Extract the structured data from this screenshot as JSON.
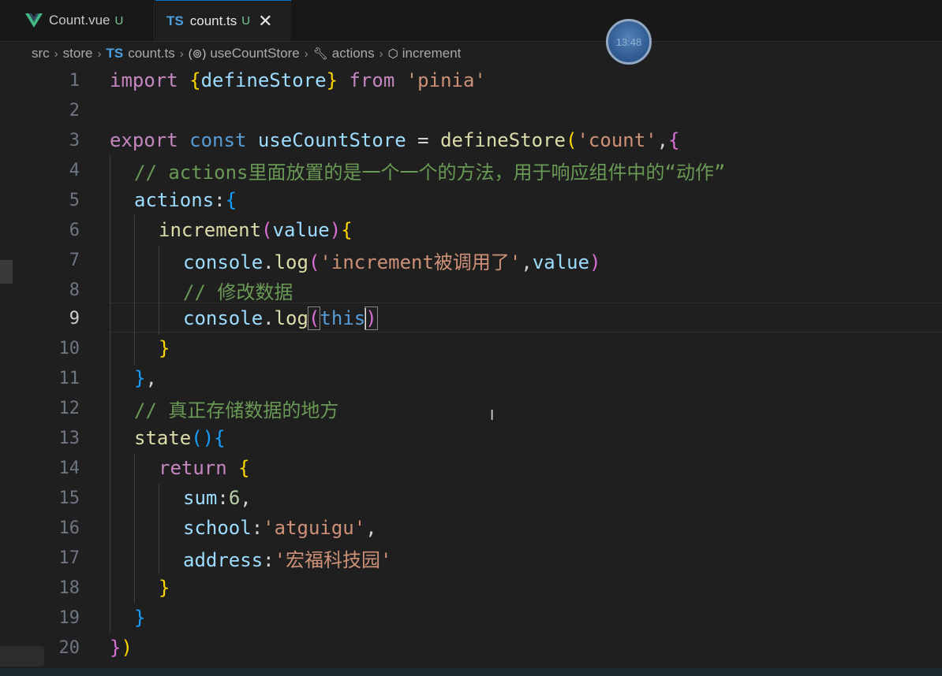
{
  "tabs": [
    {
      "label": "Count.vue",
      "status": "U",
      "icon": "vue-icon",
      "active": false
    },
    {
      "label": "count.ts",
      "status": "U",
      "icon": "typescript-icon",
      "active": true,
      "close": "✕"
    }
  ],
  "clock": {
    "time": "13:48"
  },
  "breadcrumb": {
    "src": "src",
    "store": "store",
    "ts_badge": "TS",
    "file": "count.ts",
    "symbol1": "useCountStore",
    "symbol2": "actions",
    "symbol3": "increment"
  },
  "editor": {
    "active_line": 9,
    "line_numbers": [
      "1",
      "2",
      "3",
      "4",
      "5",
      "6",
      "7",
      "8",
      "9",
      "10",
      "11",
      "12",
      "13",
      "14",
      "15",
      "16",
      "17",
      "18",
      "19",
      "20"
    ],
    "tokens": {
      "l1": [
        "import ",
        "{",
        "defineStore",
        "}",
        " from ",
        "'pinia'"
      ],
      "l3": [
        "export ",
        "const ",
        "useCountStore",
        " = ",
        "defineStore",
        "(",
        "'count'",
        ",",
        "{"
      ],
      "l4": "// actions里面放置的是一个一个的方法，用于响应组件中的“动作”",
      "l5": [
        "actions",
        ":",
        "{"
      ],
      "l6": [
        "increment",
        "(",
        "value",
        ")",
        "{"
      ],
      "l7": [
        "console",
        ".",
        "log",
        "(",
        "'increment被调用了'",
        ",",
        "value",
        ")"
      ],
      "l8": "// 修改数据",
      "l9": [
        "console",
        ".",
        "log",
        "(",
        "this",
        ")"
      ],
      "l10": "}",
      "l11": [
        "}",
        ","
      ],
      "l12": "// 真正存储数据的地方",
      "l13": [
        "state",
        "(",
        ")",
        "{"
      ],
      "l14": [
        "return ",
        "{"
      ],
      "l15": [
        "sum",
        ":",
        "6",
        ","
      ],
      "l16": [
        "school",
        ":",
        "'atguigu'",
        ","
      ],
      "l17": [
        "address",
        ":",
        "'宏福科技园'"
      ],
      "l18": "}",
      "l19": "}",
      "l20": [
        "}",
        ")"
      ]
    }
  },
  "colors": {
    "keyword": "#c586c0",
    "storage": "#569cd6",
    "function": "#dcdcaa",
    "variable": "#9cdcfe",
    "string": "#ce9178",
    "number": "#b5cea8",
    "comment": "#6a9955",
    "accent": "#0078d4"
  }
}
